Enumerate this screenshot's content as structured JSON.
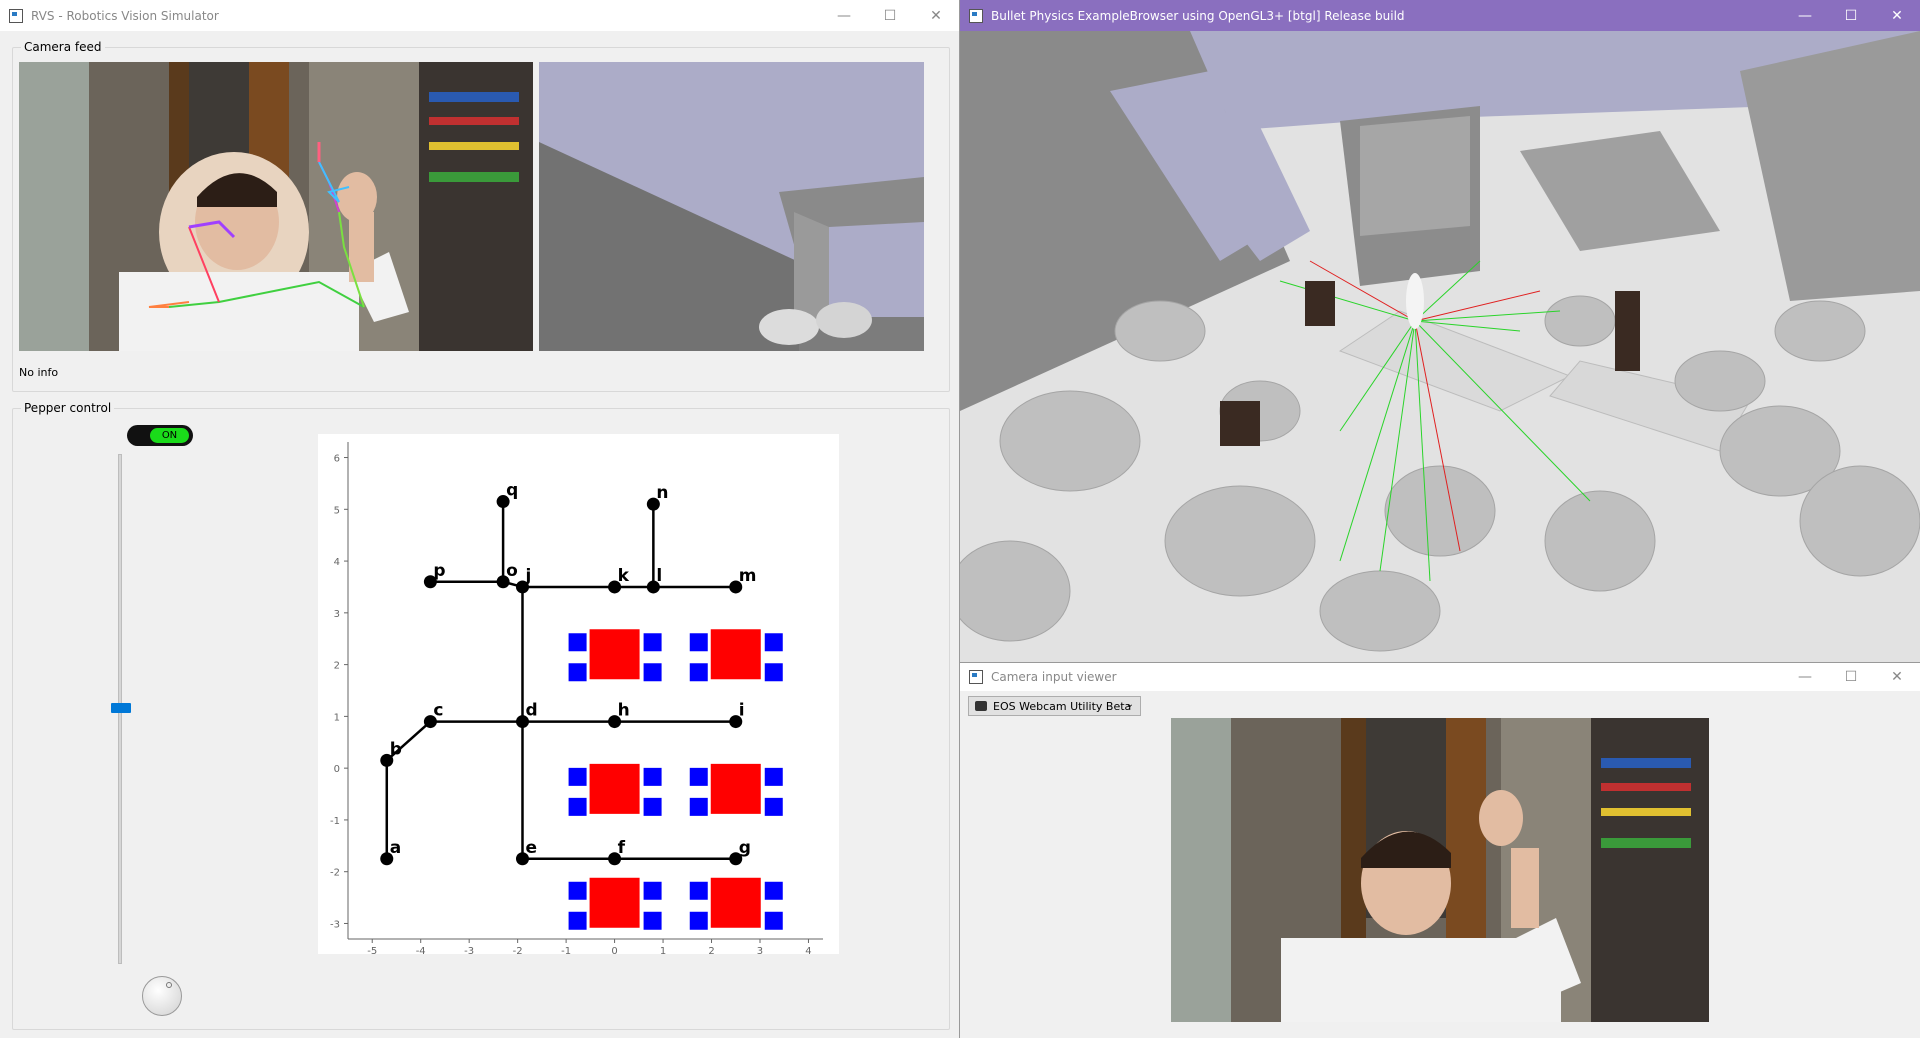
{
  "rvs": {
    "title": "RVS - Robotics Vision Simulator",
    "camera_group": "Camera feed",
    "info_text": "No info",
    "pepper_group": "Pepper control",
    "toggle_label": "ON"
  },
  "bullet": {
    "title": "Bullet Physics ExampleBrowser using OpenGL3+ [btgl] Release build"
  },
  "camviewer": {
    "title": "Camera input viewer",
    "device": "EOS Webcam Utility Beta"
  },
  "window_controls": {
    "minimize": "—",
    "maximize": "☐",
    "close": "✕"
  },
  "chart_data": {
    "type": "scatter",
    "xlim": [
      -5.5,
      4.3
    ],
    "ylim": [
      -3.3,
      6.3
    ],
    "xticks": [
      -5,
      -4,
      -3,
      -2,
      -1,
      0,
      1,
      2,
      3,
      4
    ],
    "yticks": [
      -3,
      -2,
      -1,
      0,
      1,
      2,
      3,
      4,
      5,
      6
    ],
    "nodes": [
      {
        "id": "a",
        "x": -4.7,
        "y": -1.75
      },
      {
        "id": "b",
        "x": -4.7,
        "y": 0.15
      },
      {
        "id": "c",
        "x": -3.8,
        "y": 0.9
      },
      {
        "id": "d",
        "x": -1.9,
        "y": 0.9
      },
      {
        "id": "e",
        "x": -1.9,
        "y": -1.75
      },
      {
        "id": "f",
        "x": 0,
        "y": -1.75
      },
      {
        "id": "g",
        "x": 2.5,
        "y": -1.75
      },
      {
        "id": "h",
        "x": 0,
        "y": 0.9
      },
      {
        "id": "i",
        "x": 2.5,
        "y": 0.9
      },
      {
        "id": "j",
        "x": -1.9,
        "y": 3.5
      },
      {
        "id": "k",
        "x": 0,
        "y": 3.5
      },
      {
        "id": "l",
        "x": 0.8,
        "y": 3.5
      },
      {
        "id": "m",
        "x": 2.5,
        "y": 3.5
      },
      {
        "id": "n",
        "x": 0.8,
        "y": 5.1
      },
      {
        "id": "o",
        "x": -2.3,
        "y": 3.6
      },
      {
        "id": "p",
        "x": -3.8,
        "y": 3.6
      },
      {
        "id": "q",
        "x": -2.3,
        "y": 5.15
      }
    ],
    "edges": [
      [
        "a",
        "b"
      ],
      [
        "b",
        "c"
      ],
      [
        "c",
        "d"
      ],
      [
        "d",
        "h"
      ],
      [
        "h",
        "i"
      ],
      [
        "d",
        "j"
      ],
      [
        "d",
        "e"
      ],
      [
        "e",
        "f"
      ],
      [
        "f",
        "g"
      ],
      [
        "j",
        "k"
      ],
      [
        "k",
        "l"
      ],
      [
        "l",
        "m"
      ],
      [
        "l",
        "n"
      ],
      [
        "o",
        "j"
      ],
      [
        "p",
        "o"
      ],
      [
        "o",
        "q"
      ]
    ],
    "tables": [
      {
        "x": 0,
        "y": 2.2
      },
      {
        "x": 2.5,
        "y": 2.2
      },
      {
        "x": 0,
        "y": -0.4
      },
      {
        "x": 2.5,
        "y": -0.4
      },
      {
        "x": 0,
        "y": -2.6
      },
      {
        "x": 2.5,
        "y": -2.6
      }
    ]
  }
}
